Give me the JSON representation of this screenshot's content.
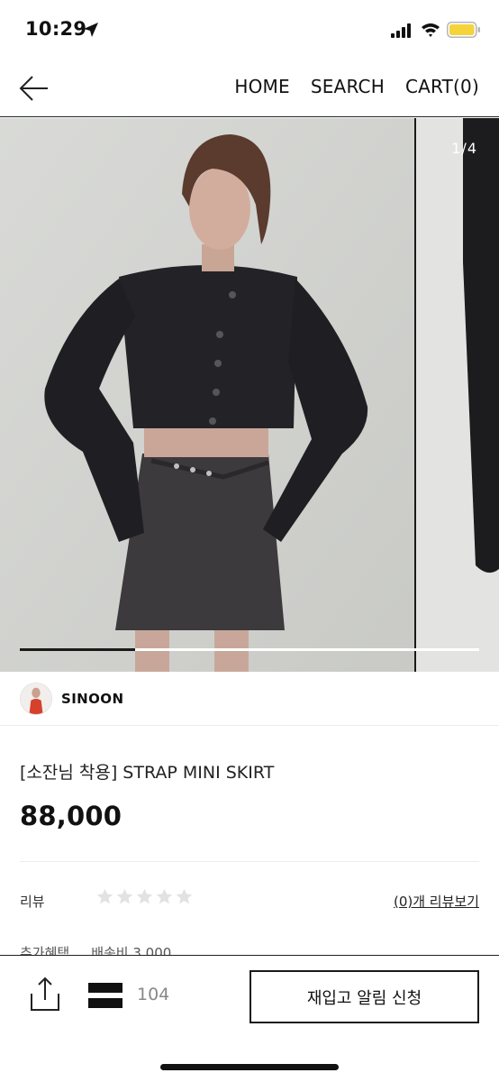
{
  "status_bar": {
    "time": "10:29",
    "icons": [
      "location-arrow-icon",
      "signal-icon",
      "wifi-icon",
      "battery-icon"
    ],
    "battery_color": "#f5d33b"
  },
  "nav": {
    "back_icon": "arrow-left-icon",
    "home": "HOME",
    "search": "SEARCH",
    "cart": "CART(0)"
  },
  "gallery": {
    "page_indicator": "1/4",
    "progress_fraction": 0.25
  },
  "seller": {
    "name": "SINOON"
  },
  "product": {
    "title": "[소잔님 착용] STRAP MINI SKIRT",
    "price": "88,000"
  },
  "review": {
    "label": "리뷰",
    "rating": 0,
    "max_rating": 5,
    "link": "(0)개 리뷰보기"
  },
  "benefit": {
    "label": "추가혜택",
    "value": "배송비 3,000"
  },
  "bottom_bar": {
    "share_icon": "share-icon",
    "like_icon": "like-icon",
    "like_count": "104",
    "restock_button": "재입고 알림 신청"
  },
  "colors": {
    "accent": "#1a1a1a",
    "star_empty": "#e2e2e2",
    "muted_text": "#888888"
  }
}
